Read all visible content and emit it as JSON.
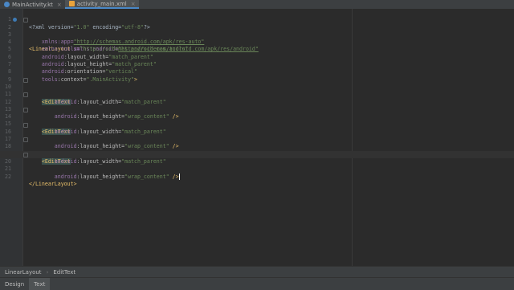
{
  "tabs": [
    {
      "label": "MainActivity.kt",
      "active": false,
      "icon": "kotlin-file-icon"
    },
    {
      "label": "activity_main.xml",
      "active": true,
      "icon": "xml-file-icon"
    }
  ],
  "editor": {
    "lines": [
      {
        "n": "1"
      },
      {
        "n": "2"
      },
      {
        "n": "3"
      },
      {
        "n": "4"
      },
      {
        "n": "5"
      },
      {
        "n": "6"
      },
      {
        "n": "7"
      },
      {
        "n": "8"
      },
      {
        "n": "9"
      },
      {
        "n": "10"
      },
      {
        "n": "11"
      },
      {
        "n": "12"
      },
      {
        "n": "13"
      },
      {
        "n": "14"
      },
      {
        "n": "15"
      },
      {
        "n": "16"
      },
      {
        "n": "17"
      },
      {
        "n": "18"
      },
      {
        "n": "19"
      },
      {
        "n": "20"
      },
      {
        "n": "21"
      },
      {
        "n": "22"
      }
    ],
    "text": {
      "xml_decl_open": "<?xml version=",
      "xml_version": "\"1.0\"",
      "xml_encoding_attr": " encoding=",
      "xml_encoding": "\"utf-8\"",
      "xml_decl_close": "?>",
      "ll_open": "<LinearLayout ",
      "xmlns_android": "xmlns:android=",
      "xmlns_android_val": "\"http://schemas.android.com/apk/res/android\"",
      "xmlns_app": "xmlns:app=",
      "xmlns_app_val": "\"http://schemas.android.com/apk/res-auto\"",
      "xmlns_tools": "xmlns:tools=",
      "xmlns_tools_val": "\"http://schemas.android.com/tools\"",
      "android_ns": "android",
      "tools_ns": "tools",
      "layout_width": ":layout_width=",
      "layout_height": ":layout_height=",
      "orientation": ":orientation=",
      "context": ":context=",
      "match_parent": "\"match_parent\"",
      "wrap_content": "\"wrap_content\"",
      "vertical": "\"vertical\"",
      "main_activity": "\".MainActivity\"",
      "gt": ">",
      "edittext_open": "<EditText",
      "self_close": " />",
      "ll_close": "</LinearLayout>"
    }
  },
  "breadcrumb": [
    "LinearLayout",
    "EditText"
  ],
  "bottom_tabs": [
    {
      "label": "Design",
      "active": false
    },
    {
      "label": "Text",
      "active": true
    }
  ]
}
